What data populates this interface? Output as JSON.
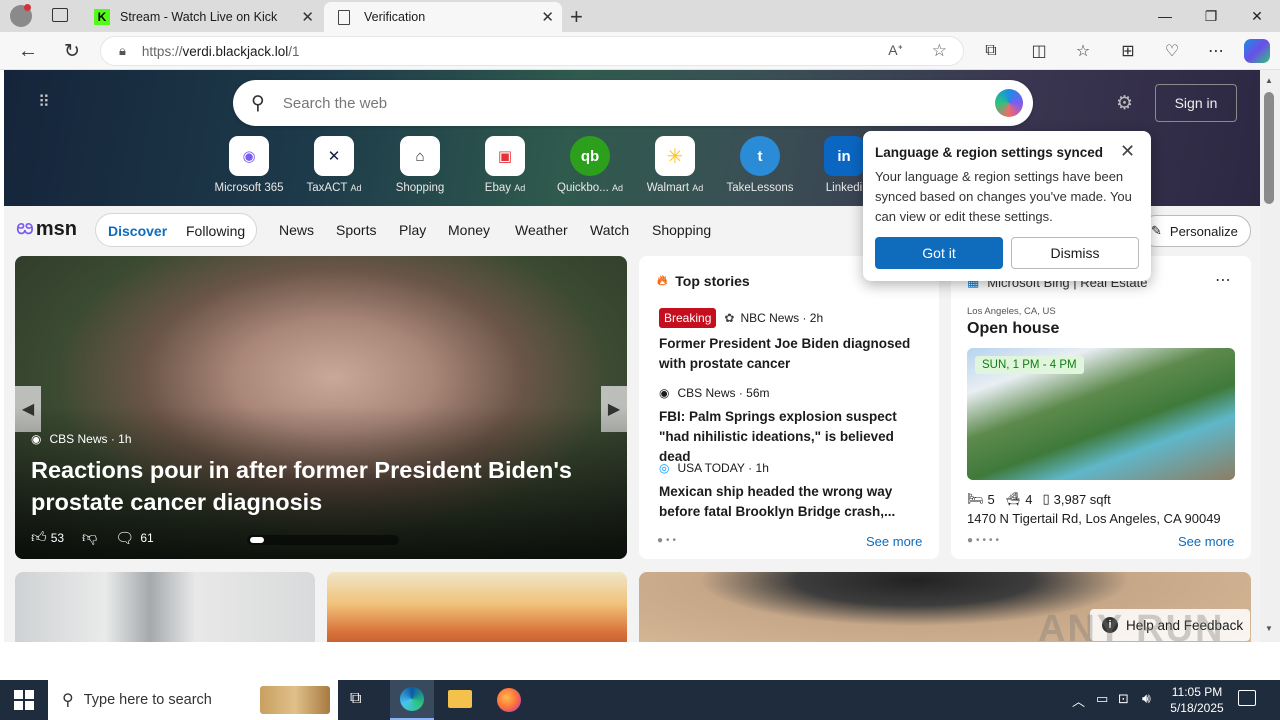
{
  "browser": {
    "tabs": [
      {
        "label": "Stream - Watch Live on Kick",
        "active": false
      },
      {
        "label": "Verification",
        "active": true
      }
    ],
    "url_prefix": "https://",
    "url_domain": "verdi.blackjack.lol",
    "url_path": "/1"
  },
  "msn": {
    "search_placeholder": "Search the web",
    "sign_in": "Sign in",
    "quick_links": [
      {
        "label": "Microsoft 365",
        "ad": "",
        "icon": "ms365-icon",
        "color": "#7b5cf0"
      },
      {
        "label": "TaxACT",
        "ad": "Ad",
        "icon": "taxact-icon",
        "color": "#10213f"
      },
      {
        "label": "Shopping",
        "ad": "",
        "icon": "tag-icon",
        "color": "#333333"
      },
      {
        "label": "Ebay",
        "ad": "Ad",
        "icon": "ebay-icon",
        "color": "#e53238"
      },
      {
        "label": "Quickbo...",
        "ad": "Ad",
        "icon": "quickbooks-icon",
        "color": "#2ca01c"
      },
      {
        "label": "Walmart",
        "ad": "Ad",
        "icon": "walmart-icon",
        "color": "#0071ce"
      },
      {
        "label": "TakeLessons",
        "ad": "",
        "icon": "takelessons-icon",
        "color": "#2a8bd6"
      },
      {
        "label": "Linkedi",
        "ad": "",
        "icon": "linkedin-icon",
        "color": "#0a66c2"
      }
    ],
    "logo": "msn",
    "discover": "Discover",
    "following": "Following",
    "nav": [
      "News",
      "Sports",
      "Play",
      "Money",
      "Weather",
      "Watch",
      "Shopping"
    ],
    "personalize": "Personalize"
  },
  "hero_story": {
    "source": "CBS News",
    "age": "1h",
    "headline": "Reactions pour in after former President Biden's prostate cancer diagnosis",
    "likes": "53",
    "comments": "61"
  },
  "top_stories": {
    "title": "Top stories",
    "items": [
      {
        "badge": "Breaking",
        "source": "NBC News",
        "age": "2h",
        "headline": "Former President Joe Biden diagnosed with prostate cancer"
      },
      {
        "badge": "",
        "source": "CBS News",
        "age": "56m",
        "headline": "FBI: Palm Springs explosion suspect \"had nihilistic ideations,\" is believed dead"
      },
      {
        "badge": "",
        "source": "USA TODAY",
        "age": "1h",
        "headline": "Mexican ship headed the wrong way before fatal Brooklyn Bridge crash,..."
      }
    ],
    "see_more": "See more"
  },
  "real_estate": {
    "source": "Microsoft Bing | Real Estate",
    "location": "Los Angeles, CA, US",
    "title": "Open house",
    "badge": "SUN, 1 PM - 4 PM",
    "beds": "5",
    "baths": "4",
    "sqft": "3,987 sqft",
    "address": "1470 N Tigertail Rd, Los Angeles, CA 90049",
    "see_more": "See more"
  },
  "popup": {
    "title": "Language & region settings synced",
    "body": "Your language & region settings have been synced based on changes you've made. You can view or edit these settings.",
    "got_it": "Got it",
    "dismiss": "Dismiss"
  },
  "help": "Help and Feedback",
  "watermark": "ANY RUN",
  "taskbar": {
    "search_placeholder": "Type here to search",
    "time": "11:05 PM",
    "date": "5/18/2025"
  },
  "colors": {
    "accent": "#0f6cbd",
    "breaking": "#c50f1f",
    "taskbar": "#1f2c3d"
  }
}
